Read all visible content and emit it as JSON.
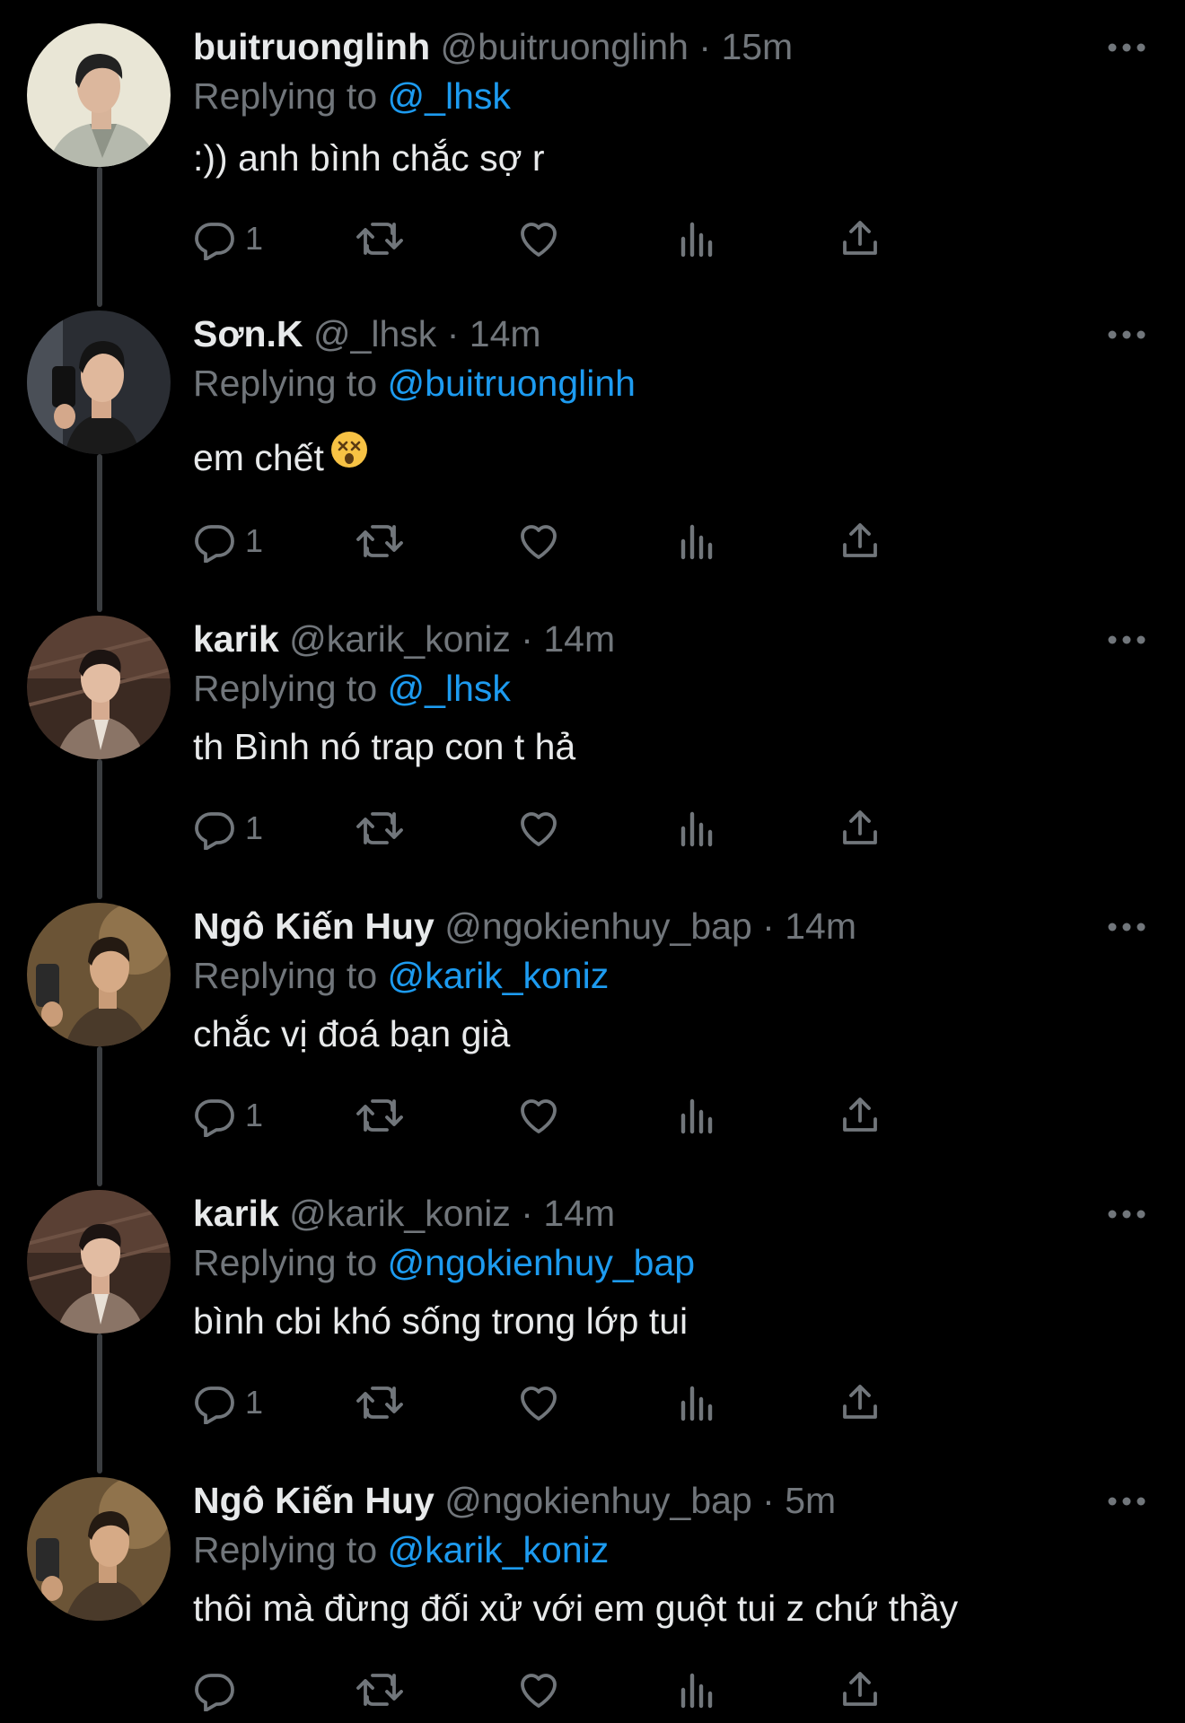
{
  "tweets": [
    {
      "name": "buitruonglinh",
      "handle": "@buitruonglinh",
      "time": "15m",
      "replying_label": "Replying to",
      "replying_to": "@_lhsk",
      "text": ":)) anh bình chắc sợ r",
      "reply_count": "1"
    },
    {
      "name": "Sơn.K",
      "handle": "@_lhsk",
      "time": "14m",
      "replying_label": "Replying to",
      "replying_to": "@buitruonglinh",
      "text": "em chết",
      "emoji": "dizzy-face-emoji",
      "reply_count": "1"
    },
    {
      "name": "karik",
      "handle": "@karik_koniz",
      "time": "14m",
      "replying_label": "Replying to",
      "replying_to": "@_lhsk",
      "text": "th Bình nó trap con t hả",
      "reply_count": "1"
    },
    {
      "name": "Ngô Kiến Huy",
      "handle": "@ngokienhuy_bap",
      "time": "14m",
      "replying_label": "Replying to",
      "replying_to": "@karik_koniz",
      "text": "chắc vị đoá bạn già",
      "reply_count": "1"
    },
    {
      "name": "karik",
      "handle": "@karik_koniz",
      "time": "14m",
      "replying_label": "Replying to",
      "replying_to": "@ngokienhuy_bap",
      "text": "bình cbi khó sống trong lớp tui",
      "reply_count": "1"
    },
    {
      "name": "Ngô Kiến Huy",
      "handle": "@ngokienhuy_bap",
      "time": "5m",
      "replying_label": "Replying to",
      "replying_to": "@karik_koniz",
      "text": "thôi mà đừng đối xử với em guột tui z chứ thầy",
      "reply_count": ""
    }
  ],
  "separator": "·",
  "icons": {
    "reply": "reply-icon",
    "retweet": "retweet-icon",
    "like": "heart-icon",
    "views": "views-icon",
    "share": "share-icon",
    "more": "more-icon"
  },
  "colors": {
    "background": "#000000",
    "text": "#e7e9ea",
    "muted": "#71767b",
    "accent": "#1d9bf0"
  }
}
